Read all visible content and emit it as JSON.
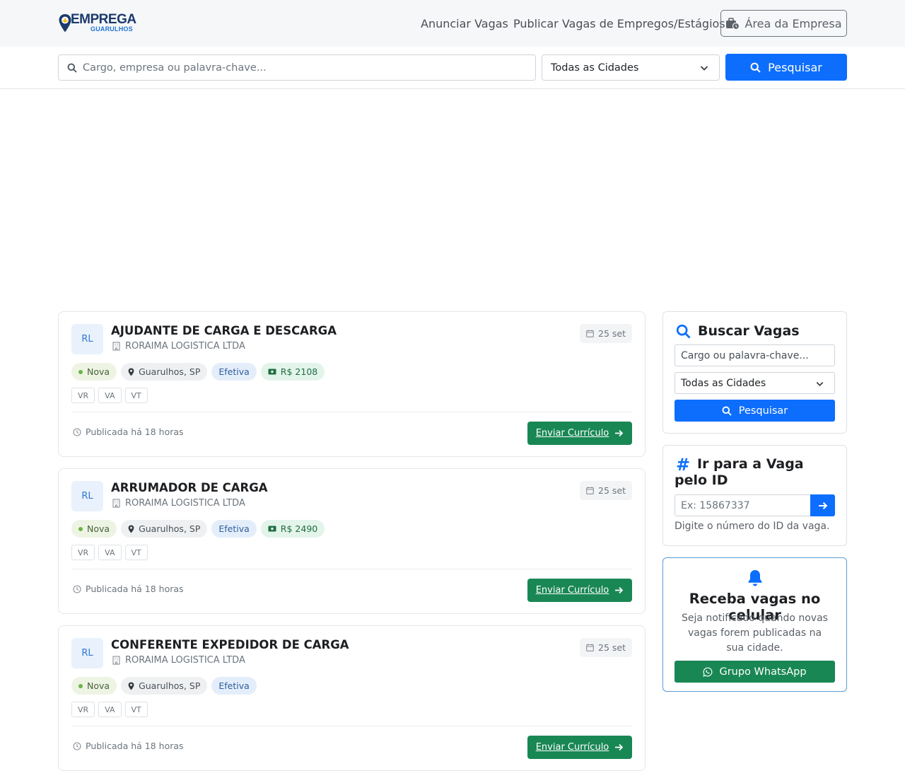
{
  "header": {
    "logo_text": "EMPREGA",
    "logo_subtext": "GUARULHOS",
    "nav": [
      "Anunciar Vagas",
      "Publicar Vagas de Empregos/Estágios"
    ],
    "area_button": "Área da Empresa"
  },
  "search": {
    "placeholder": "Cargo, empresa ou palavra-chave...",
    "city_selected": "Todas as Cidades",
    "button": "Pesquisar"
  },
  "jobs": [
    {
      "initials": "RL",
      "title": "AJUDANTE DE CARGA E DESCARGA",
      "company": "RORAIMA LOGISTICA LTDA",
      "date": "25 set",
      "status": "Nova",
      "location": "Guarulhos, SP",
      "contract": "Efetiva",
      "salary": "R$ 2108",
      "benefits": [
        "VR",
        "VA",
        "VT"
      ],
      "posted": "Publicada há 18 horas",
      "cta": "Enviar Currículo"
    },
    {
      "initials": "RL",
      "title": "ARRUMADOR DE CARGA",
      "company": "RORAIMA LOGISTICA LTDA",
      "date": "25 set",
      "status": "Nova",
      "location": "Guarulhos, SP",
      "contract": "Efetiva",
      "salary": "R$ 2490",
      "benefits": [
        "VR",
        "VA",
        "VT"
      ],
      "posted": "Publicada há 18 horas",
      "cta": "Enviar Currículo"
    },
    {
      "initials": "RL",
      "title": "CONFERENTE EXPEDIDOR DE CARGA",
      "company": "RORAIMA LOGISTICA LTDA",
      "date": "25 set",
      "status": "Nova",
      "location": "Guarulhos, SP",
      "contract": "Efetiva",
      "salary": "",
      "benefits": [
        "VR",
        "VA",
        "VT"
      ],
      "posted": "Publicada há 18 horas",
      "cta": "Enviar Currículo"
    }
  ],
  "sidebar": {
    "search_box": {
      "title": "Buscar Vagas",
      "placeholder": "Cargo ou palavra-chave...",
      "city_selected": "Todas as Cidades",
      "button": "Pesquisar"
    },
    "id_box": {
      "title": "Ir para a Vaga pelo ID",
      "placeholder": "Ex: 15867337",
      "help": "Digite o número do ID da vaga."
    },
    "notify_box": {
      "title": "Receba vagas no celular",
      "description": "Seja notificado quando novas vagas forem publicadas na sua cidade.",
      "button": "Grupo WhatsApp"
    }
  },
  "colors": {
    "primary": "#0d6efd",
    "success": "#198754",
    "brand_dark": "#1b3a6b"
  }
}
